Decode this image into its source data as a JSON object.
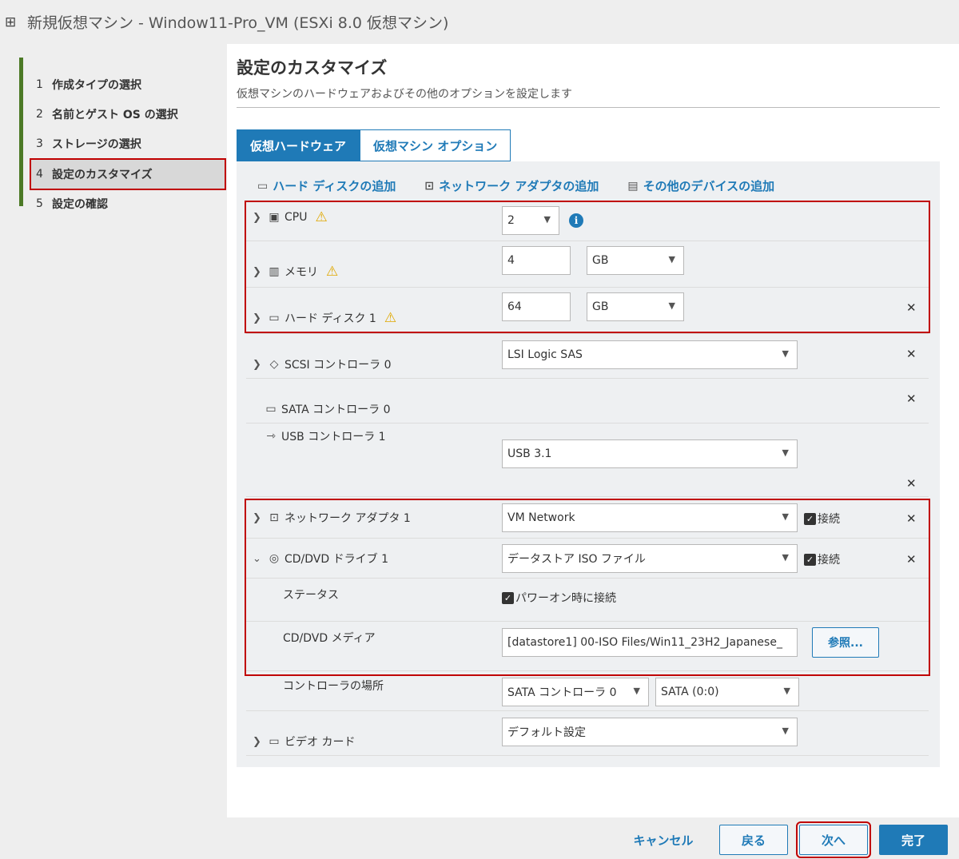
{
  "window": {
    "title": "新規仮想マシン - Window11-Pro_VM (ESXi 8.0 仮想マシン)"
  },
  "steps": [
    {
      "num": "1",
      "label": "作成タイプの選択"
    },
    {
      "num": "2",
      "label": "名前とゲスト OS の選択"
    },
    {
      "num": "3",
      "label": "ストレージの選択"
    },
    {
      "num": "4",
      "label": "設定のカスタマイズ"
    },
    {
      "num": "5",
      "label": "設定の確認"
    }
  ],
  "page": {
    "title": "設定のカスタマイズ",
    "subtitle": "仮想マシンのハードウェアおよびその他のオプションを設定します"
  },
  "tabs": {
    "hardware": "仮想ハードウェア",
    "options": "仮想マシン オプション"
  },
  "actions": {
    "add_disk": "ハード ディスクの追加",
    "add_network": "ネットワーク アダプタの追加",
    "add_other": "その他のデバイスの追加"
  },
  "devices": {
    "cpu": {
      "label": "CPU",
      "value": "2"
    },
    "memory": {
      "label": "メモリ",
      "value": "4",
      "unit": "GB"
    },
    "disk": {
      "label": "ハード ディスク 1",
      "value": "64",
      "unit": "GB"
    },
    "scsi": {
      "label": "SCSI コントローラ 0",
      "value": "LSI Logic SAS"
    },
    "sata": {
      "label": "SATA コントローラ 0"
    },
    "usb": {
      "label": "USB コントローラ 1",
      "value": "USB 3.1"
    },
    "network": {
      "label": "ネットワーク アダプタ 1",
      "value": "VM Network",
      "connect": "接続"
    },
    "cddvd": {
      "label": "CD/DVD ドライブ 1",
      "value": "データストア ISO ファイル",
      "connect": "接続"
    },
    "status": {
      "label": "ステータス",
      "value": "パワーオン時に接続"
    },
    "media": {
      "label": "CD/DVD メディア",
      "value": "[datastore1] 00-ISO Files/Win11_23H2_Japanese_",
      "browse": "参照..."
    },
    "controller": {
      "label": "コントローラの場所",
      "controller": "SATA コントローラ 0",
      "slot": "SATA (0:0)"
    },
    "video": {
      "label": "ビデオ カード",
      "value": "デフォルト設定"
    }
  },
  "footer": {
    "cancel": "キャンセル",
    "back": "戻る",
    "next": "次へ",
    "finish": "完了"
  },
  "colors": {
    "accent": "#1f7ab7",
    "highlight": "#c00000",
    "step_bar": "#4c7a26",
    "warning": "#e0a800"
  }
}
